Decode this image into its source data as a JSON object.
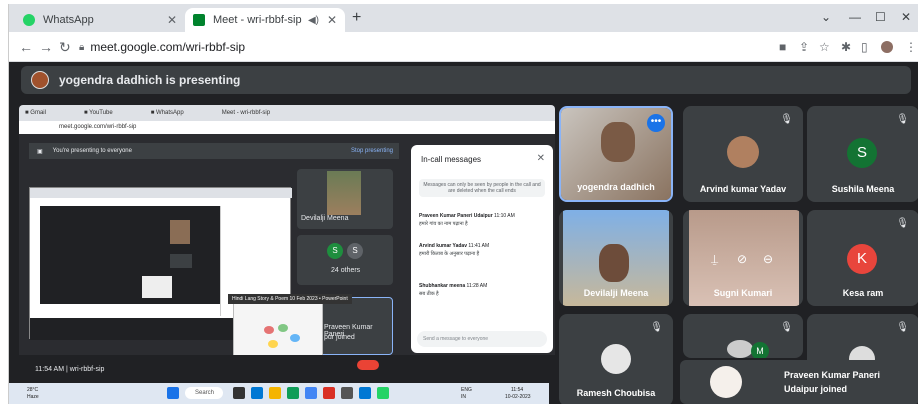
{
  "browser": {
    "tabs": [
      {
        "title": "WhatsApp",
        "close": "✕"
      },
      {
        "title": "Meet - wri-rbbf-sip",
        "close": "✕"
      }
    ],
    "new_tab": "+",
    "window_controls": [
      "⌄",
      "—",
      "☐",
      "✕"
    ],
    "url": "meet.google.com/wri-rbbf-sip",
    "accent": "#1a73e8"
  },
  "banner": {
    "text": "yogendra dadhich is presenting"
  },
  "presentation": {
    "present_bar": "You're presenting to everyone",
    "stop_label": "Stop presenting",
    "tile_names": [
      "Devilalji Meena",
      "24 others",
      "Praveen Kumar Paneri",
      "pur joined"
    ],
    "circle_letters": [
      "S",
      "S"
    ],
    "slide_caption": "Hindi Lang Story & Poem 10 Feb 2023 • PowerPoint",
    "footer_time": "11:54 AM | wri-rbbf-sip",
    "messages_panel": {
      "title": "In-call messages",
      "note": "Messages can only be seen by people in the call and are deleted when the call ends",
      "messages": [
        {
          "author": "Praveen Kumar Paneri Udaipur",
          "time": "11:10 AM",
          "text": "हमारे गांव का नाम पढ़ाना है"
        },
        {
          "author": "Arvind kumar Yadav",
          "time": "11:41 AM",
          "text": "हमारी किताब के अनुसार पढ़ाना है"
        },
        {
          "author": "Shubhankar meena",
          "time": "11:28 AM",
          "text": "सब ठीक है"
        }
      ],
      "send_placeholder": "Send a message to everyone"
    }
  },
  "meeting": {
    "time": "11:54 AM",
    "code": "wri-rbbf-sip"
  },
  "taskbar": {
    "weather_temp": "28°C",
    "weather_label": "Haze",
    "search": "Search",
    "lang": "ENG",
    "region": "IN",
    "clock_time": "11:54",
    "clock_date": "10-02-2023"
  },
  "participants": [
    {
      "name": "yogendra dadhich",
      "type": "video"
    },
    {
      "name": "Arvind kumar Yadav",
      "type": "avatar"
    },
    {
      "name": "Sushila Meena",
      "type": "letter",
      "letter": "S",
      "color": "#137333"
    },
    {
      "name": "Devilalji Meena",
      "type": "video"
    },
    {
      "name": "Sugni Kumari",
      "type": "video"
    },
    {
      "name": "Kesa ram",
      "type": "letter",
      "letter": "K",
      "color": "#e8453c"
    },
    {
      "name": "Ramesh Choubisa",
      "type": "avatar"
    },
    {
      "name": "",
      "type": "avatar",
      "badge": "M"
    },
    {
      "name": "",
      "type": "avatar"
    }
  ],
  "notification": {
    "text": "Praveen Kumar Paneri Udaipur joined"
  }
}
